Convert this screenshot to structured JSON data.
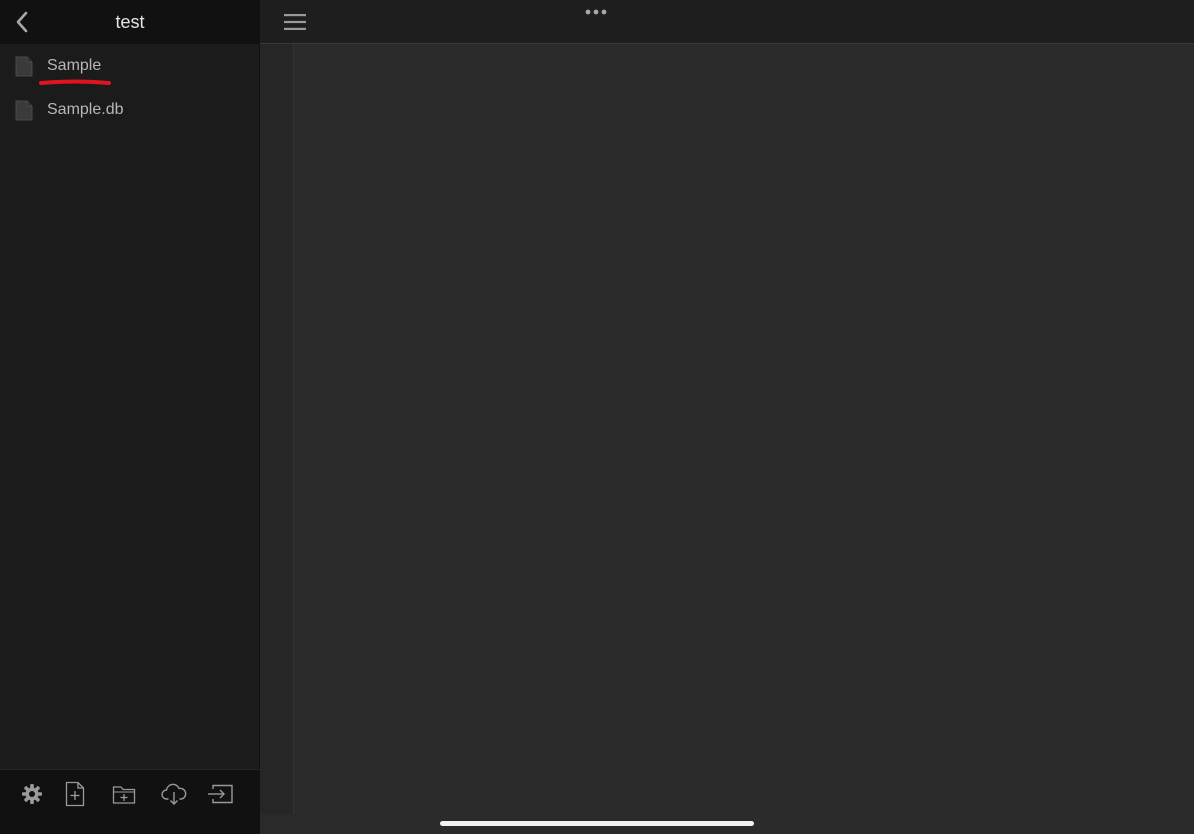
{
  "sidebar": {
    "title": "test",
    "back_icon": "chevron-left-icon",
    "files": [
      {
        "name": "Sample",
        "icon": "document-icon",
        "highlighted": true
      },
      {
        "name": "Sample.db",
        "icon": "document-icon",
        "highlighted": false
      }
    ],
    "toolbar": [
      {
        "icon": "gear-icon"
      },
      {
        "icon": "new-file-icon"
      },
      {
        "icon": "new-folder-icon"
      },
      {
        "icon": "cloud-download-icon"
      },
      {
        "icon": "import-icon"
      }
    ]
  },
  "header": {
    "menu_icon": "hamburger-menu-icon",
    "more_icon": "more-dots-icon"
  },
  "colors": {
    "sidebar_bg": "#1b1b1b",
    "header_bg": "#111111",
    "editor_bg": "#2b2b2b",
    "text": "#b7b7b7",
    "highlight_underline": "#e0141e"
  }
}
